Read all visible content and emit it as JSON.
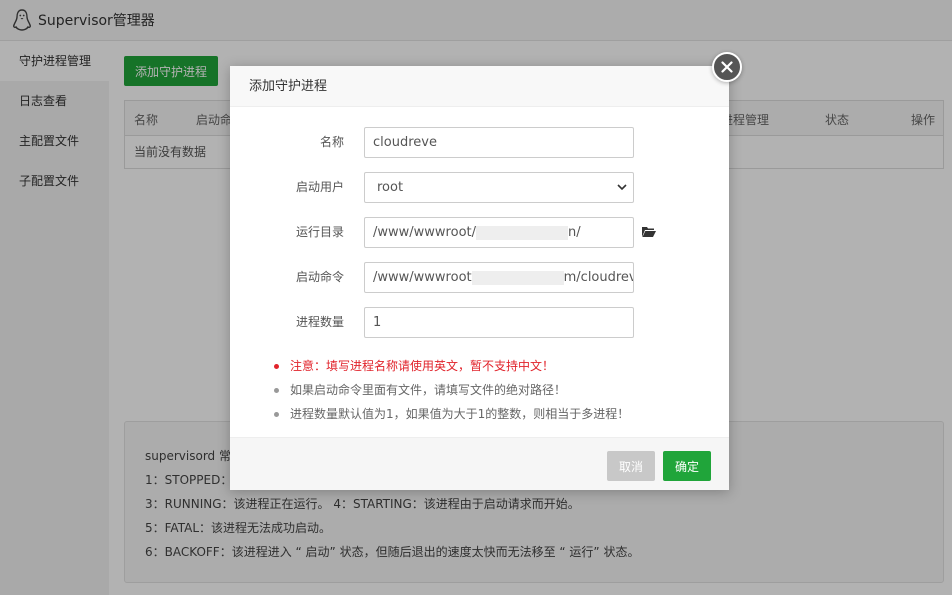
{
  "app": {
    "title": "Supervisor管理器",
    "logo_icon": "penguin-icon"
  },
  "sidebar": {
    "items": [
      {
        "label": "守护进程管理",
        "active": true
      },
      {
        "label": "日志查看"
      },
      {
        "label": "主配置文件"
      },
      {
        "label": "子配置文件"
      }
    ]
  },
  "main": {
    "add_button": "添加守护进程",
    "table": {
      "headers": [
        "名称",
        "启动命",
        "进程管理",
        "状态",
        "操作"
      ],
      "empty_text": "当前没有数据"
    },
    "info": {
      "lines": [
        "supervisord 常",
        "1：STOPPED：",
        "3：RUNNING：该进程正在运行。 4：STARTING：该进程由于启动请求而开始。",
        "5：FATAL：该进程无法成功启动。",
        "6：BACKOFF：该进程进入 “ 启动” 状态，但随后退出的速度太快而无法移至 “ 运行” 状态。"
      ]
    }
  },
  "modal": {
    "title": "添加守护进程",
    "fields": {
      "name": {
        "label": "名称",
        "value": "cloudreve"
      },
      "user": {
        "label": "启动用户",
        "value": "root"
      },
      "dir": {
        "label": "运行目录",
        "value_prefix": "/www/wwwroot/",
        "value_suffix": "n/"
      },
      "cmd": {
        "label": "启动命令",
        "value_prefix": "/www/wwwroot",
        "value_suffix": "m/cloudreve"
      },
      "num": {
        "label": "进程数量",
        "value": "1"
      }
    },
    "notes": [
      "注意：填写进程名称请使用英文，暂不支持中文！",
      "如果启动命令里面有文件，请填写文件的绝对路径！",
      "进程数量默认值为1，如果值为大于1的整数，则相当于多进程！"
    ],
    "cancel": "取消",
    "ok": "确定"
  },
  "colors": {
    "primary": "#20a53a",
    "warning": "#e1232b"
  }
}
